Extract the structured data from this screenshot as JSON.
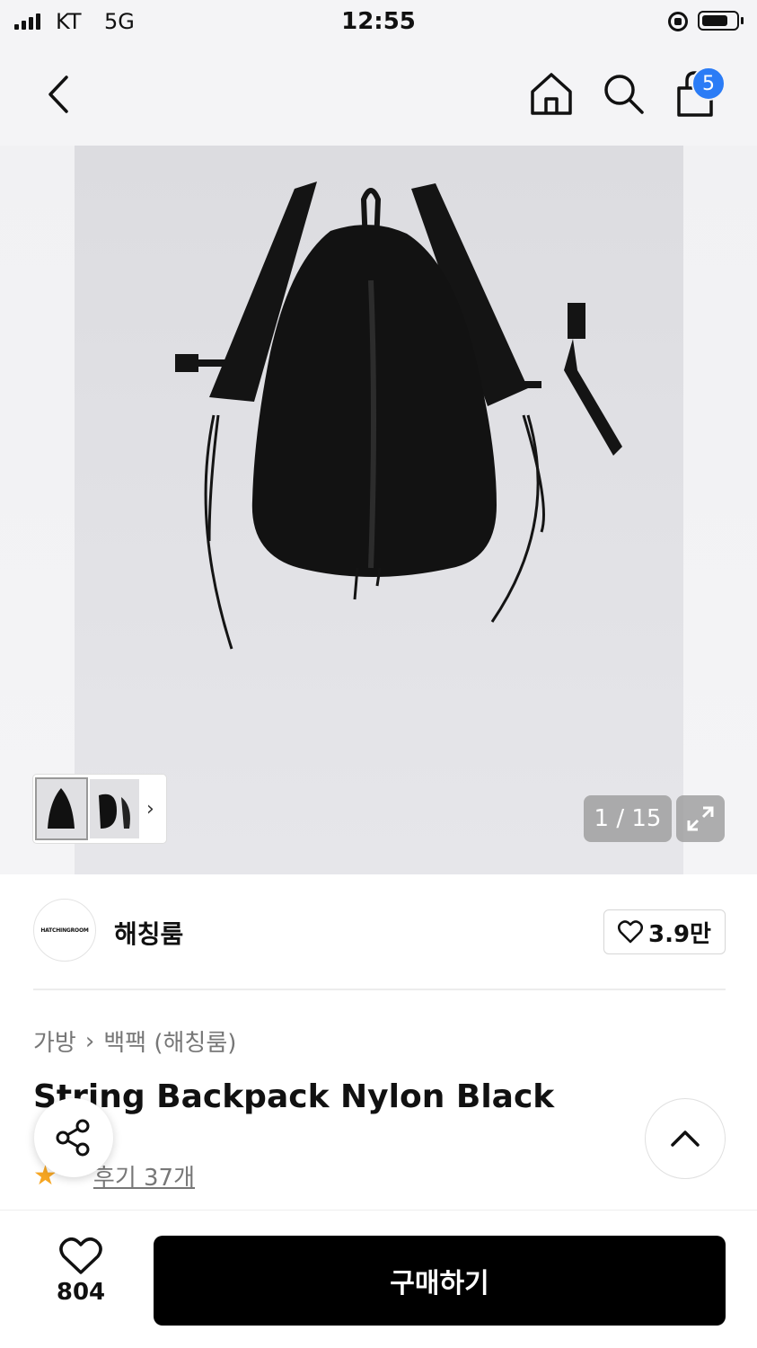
{
  "status_bar": {
    "carrier": "KT",
    "network": "5G",
    "time": "12:55"
  },
  "nav": {
    "cart_badge": "5",
    "icons": [
      "back-icon",
      "home-icon",
      "search-icon",
      "bag-icon"
    ]
  },
  "gallery": {
    "counter": "1 / 15",
    "thumb_arrow": "›",
    "icons": [
      "expand-icon"
    ]
  },
  "brand": {
    "logo_text": "HATCHINGROOM",
    "name": "해칭룸",
    "likes": "3.9만"
  },
  "breadcrumb": {
    "category": "가방",
    "separator": "›",
    "subcategory": "백팩 (해칭룸)"
  },
  "product": {
    "title": "String Backpack Nylon Black",
    "review_link": "후기 37개"
  },
  "bottom_bar": {
    "wish_count": "804",
    "buy_label": "구매하기"
  },
  "colors": {
    "badge": "#2b7cf6",
    "buy_button": "#000000",
    "star": "#f6a623"
  }
}
